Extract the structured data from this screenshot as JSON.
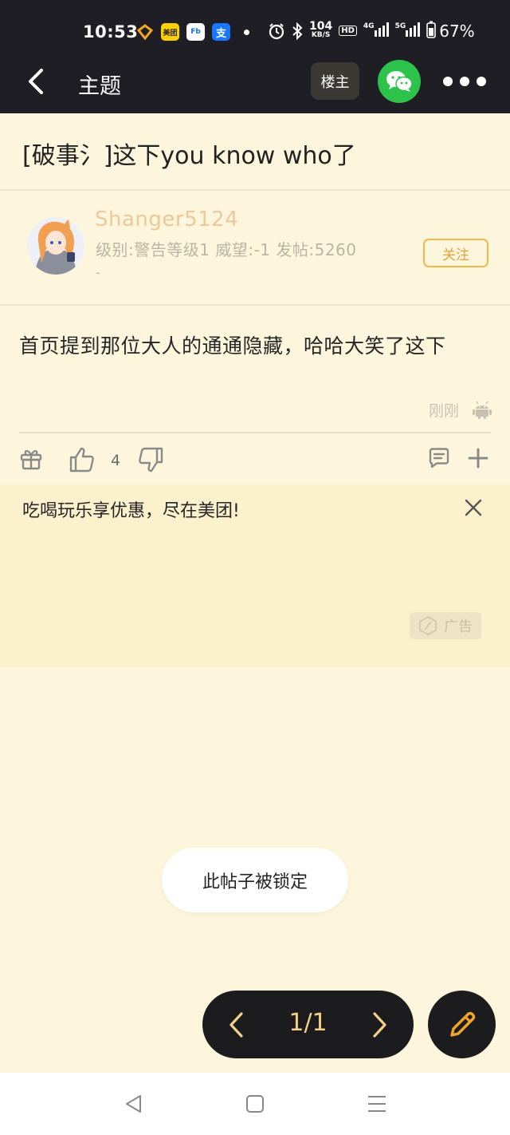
{
  "status_bar": {
    "time": "10:53",
    "app_icons": [
      "huawei-pay-icon",
      "meituan-icon",
      "fb-icon",
      "alipay-icon"
    ],
    "meituan_label": "美团",
    "fb_label": "Fb",
    "alipay_label": "支",
    "net_speed_value": "104",
    "net_speed_unit": "KB/S",
    "hd_label": "HD",
    "sig1_label": "4G",
    "sig2_label": "5G",
    "battery": "67%"
  },
  "header": {
    "title": "主题",
    "owner_button": "楼主"
  },
  "post": {
    "title": "[破事氵]这下you know who了",
    "author": {
      "name": "Shanger5124",
      "stats": "级别:警告等级1 威望:-1 发帖:5260",
      "extra": "-",
      "follow_label": "关注"
    },
    "content": "首页提到那位大人的通通隐藏，哈哈大笑了这下",
    "time": "刚刚",
    "like_count": "4"
  },
  "ad": {
    "text": "吃喝玩乐享优惠，尽在美团!",
    "badge": "广告"
  },
  "toast": "此帖子被锁定",
  "pager": {
    "text": "1/1"
  },
  "colors": {
    "background": "#fdf6dd",
    "header": "#1f1e24",
    "accent": "#f2b74b",
    "wechat": "#2dc24a",
    "ad_background": "#fcf1cd"
  }
}
